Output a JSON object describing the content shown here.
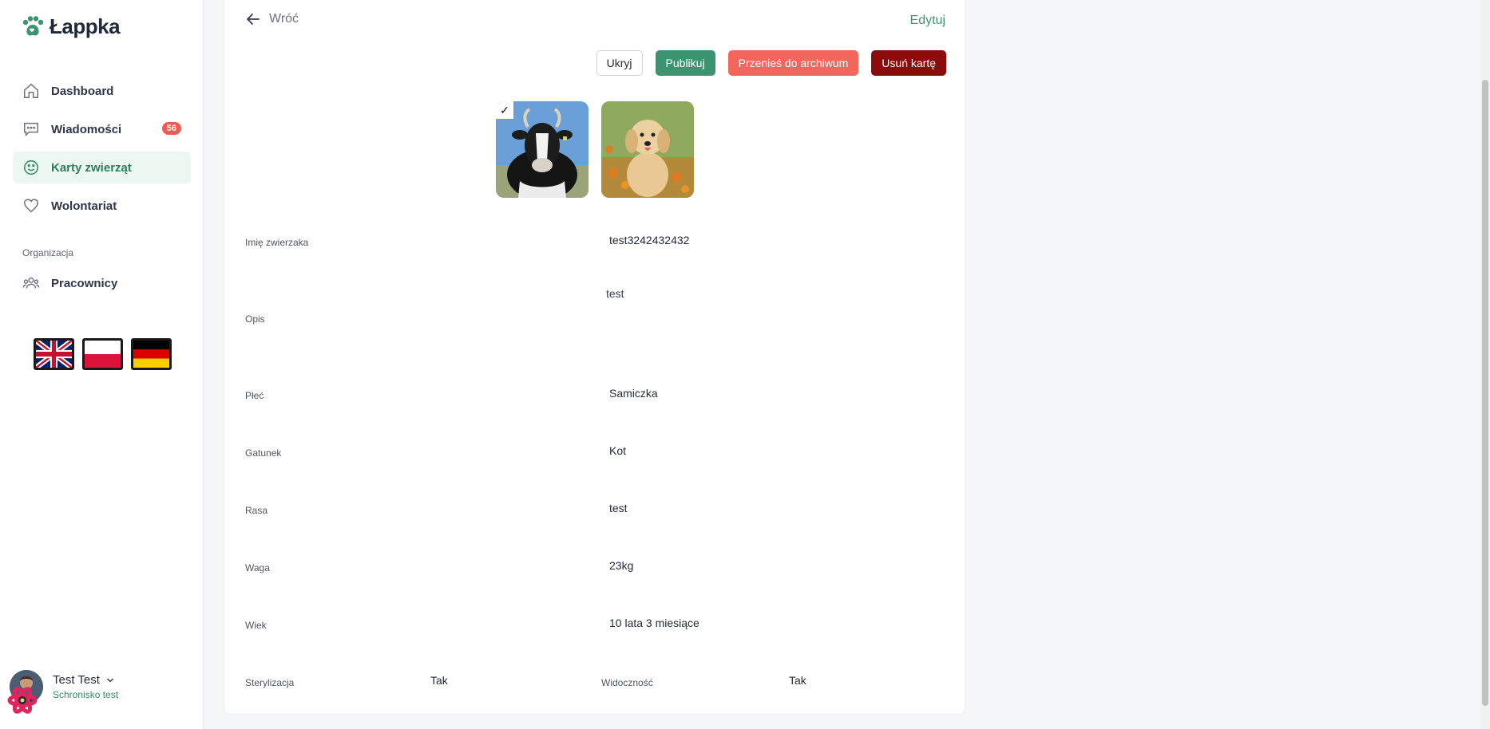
{
  "app": {
    "name": "Łappka"
  },
  "sidebar": {
    "items": [
      {
        "label": "Dashboard",
        "icon": "home-icon"
      },
      {
        "label": "Wiadomości",
        "icon": "chat-icon",
        "badge": "56"
      },
      {
        "label": "Karty zwierząt",
        "icon": "smile-icon",
        "active": true
      },
      {
        "label": "Wolontariat",
        "icon": "heart-icon"
      }
    ],
    "section_title": "Organizacja",
    "org_items": [
      {
        "label": "Pracownicy",
        "icon": "users-icon"
      }
    ],
    "languages": [
      "English",
      "Polski",
      "Deutsch"
    ]
  },
  "user": {
    "name": "Test Test",
    "org": "Schronisko test"
  },
  "main": {
    "back_label": "Wróć",
    "edit_label": "Edytuj",
    "actions": {
      "hide": "Ukryj",
      "publish": "Publikuj",
      "archive": "Przenieś do archiwum",
      "delete": "Usuń kartę"
    },
    "fields": {
      "name": {
        "label": "Imię zwierzaka",
        "value": "test3242432432"
      },
      "description": {
        "label": "Opis",
        "value": "test"
      },
      "sex": {
        "label": "Płeć",
        "value": "Samiczka"
      },
      "species": {
        "label": "Gatunek",
        "value": "Kot"
      },
      "breed": {
        "label": "Rasa",
        "value": "test"
      },
      "weight": {
        "label": "Waga",
        "value": "23kg"
      },
      "age": {
        "label": "Wiek",
        "value": "10 lata 3 miesiące"
      },
      "sterilization": {
        "label": "Sterylizacja",
        "value": "Tak"
      },
      "visibility": {
        "label": "Widoczność",
        "value": "Tak"
      }
    }
  },
  "colors": {
    "brand": "#3b9470",
    "danger": "#8b0a0a",
    "archive": "#f2665b",
    "badge": "#ef5b4f"
  }
}
